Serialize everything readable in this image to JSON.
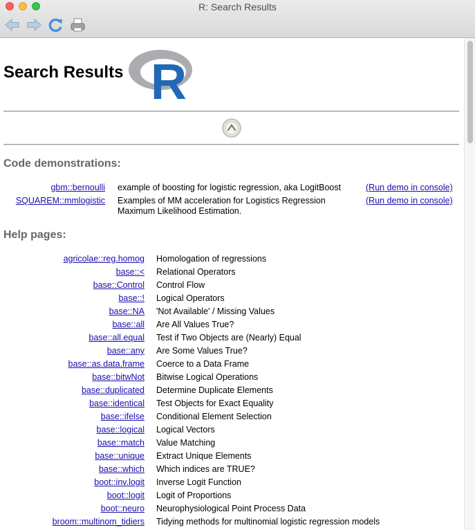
{
  "window": {
    "title": "R: Search Results"
  },
  "toolbar": {
    "back_icon": "arrow-left-icon",
    "forward_icon": "arrow-right-icon",
    "reload_icon": "refresh-icon",
    "print_icon": "printer-icon"
  },
  "page": {
    "title": "Search Results",
    "logo": "R"
  },
  "code_demos": {
    "heading": "Code demonstrations:",
    "rows": [
      {
        "name": "gbm::bernoulli",
        "desc": "example of boosting for logistic regression, aka LogitBoost",
        "action": "(Run demo in console)"
      },
      {
        "name": "SQUAREM::mmlogistic",
        "desc": "Examples of MM acceleration for Logistics Regression Maximum Likelihood Estimation.",
        "action": "(Run demo in console)"
      }
    ]
  },
  "help_pages": {
    "heading": "Help pages:",
    "rows": [
      {
        "name": "agricolae::reg.homog",
        "desc": "Homologation of regressions"
      },
      {
        "name": "base::<",
        "desc": "Relational Operators"
      },
      {
        "name": "base::Control",
        "desc": "Control Flow"
      },
      {
        "name": "base::!",
        "desc": "Logical Operators"
      },
      {
        "name": "base::NA",
        "desc": "'Not Available' / Missing Values"
      },
      {
        "name": "base::all",
        "desc": "Are All Values True?"
      },
      {
        "name": "base::all.equal",
        "desc": "Test if Two Objects are (Nearly) Equal"
      },
      {
        "name": "base::any",
        "desc": "Are Some Values True?"
      },
      {
        "name": "base::as.data.frame",
        "desc": "Coerce to a Data Frame"
      },
      {
        "name": "base::bitwNot",
        "desc": "Bitwise Logical Operations"
      },
      {
        "name": "base::duplicated",
        "desc": "Determine Duplicate Elements"
      },
      {
        "name": "base::identical",
        "desc": "Test Objects for Exact Equality"
      },
      {
        "name": "base::ifelse",
        "desc": "Conditional Element Selection"
      },
      {
        "name": "base::logical",
        "desc": "Logical Vectors"
      },
      {
        "name": "base::match",
        "desc": "Value Matching"
      },
      {
        "name": "base::unique",
        "desc": "Extract Unique Elements"
      },
      {
        "name": "base::which",
        "desc": "Which indices are TRUE?"
      },
      {
        "name": "boot::inv.logit",
        "desc": "Inverse Logit Function"
      },
      {
        "name": "boot::logit",
        "desc": "Logit of Proportions"
      },
      {
        "name": "boot::neuro",
        "desc": "Neurophysiological Point Process Data"
      },
      {
        "name": "broom::multinom_tidiers",
        "desc": "Tidying methods for multinomial logistic regression models"
      }
    ]
  }
}
